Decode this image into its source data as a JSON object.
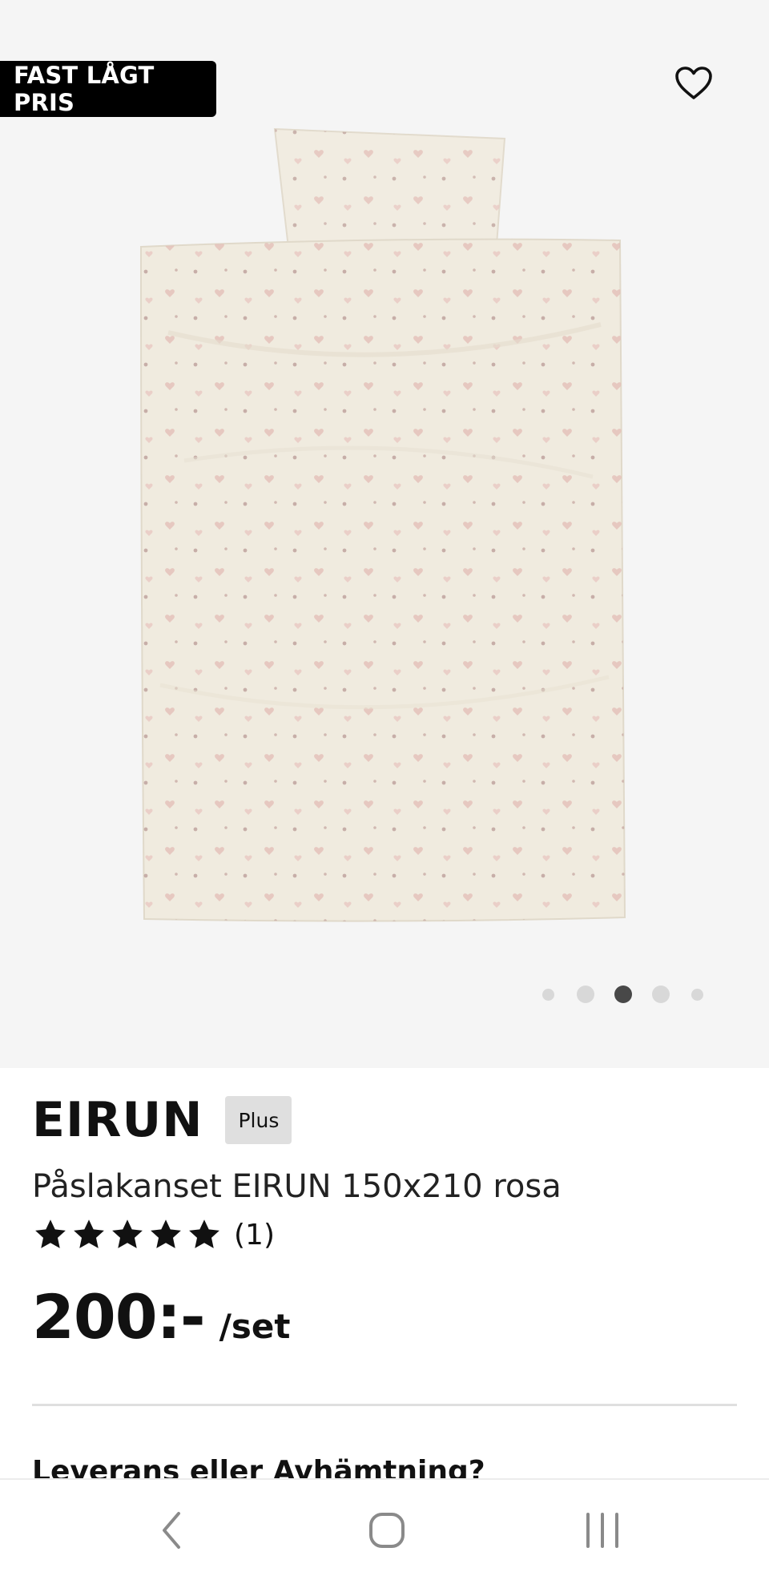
{
  "gallery": {
    "badge_label": "FAST LÅGT PRIS",
    "favorite_icon": "heart-icon",
    "image_alt": "Påslakanset EIRUN 150x210 rosa",
    "pagination": {
      "total": 5,
      "active_index": 2
    }
  },
  "product": {
    "name": "EIRUN",
    "tag": "Plus",
    "description": "Påslakanset EIRUN 150x210 rosa",
    "rating": {
      "stars": 5,
      "max": 5,
      "count_label": "(1)"
    },
    "price": "200:-",
    "unit": "/set"
  },
  "delivery": {
    "heading": "Leverans eller Avhämtning?"
  },
  "system_nav": {
    "back_icon": "back-chevron-icon",
    "home_icon": "home-icon",
    "recents_icon": "recents-icon"
  },
  "colors": {
    "gallery_bg": "#f5f5f5",
    "badge_bg": "#000000",
    "text": "#111111",
    "divider": "#dfdfdf"
  }
}
